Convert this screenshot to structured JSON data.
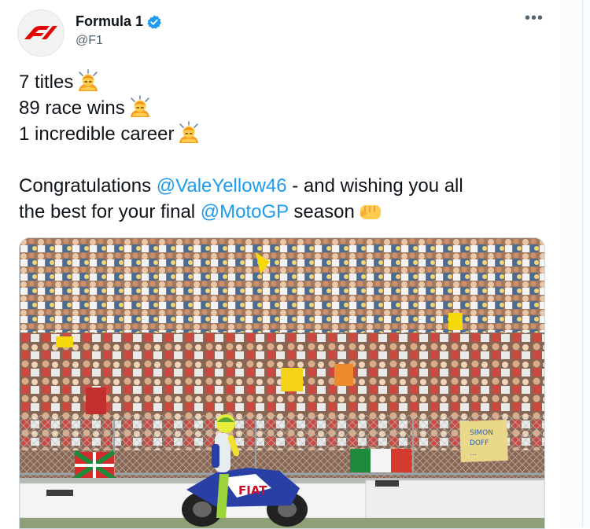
{
  "tweet": {
    "author": {
      "display_name": "Formula 1",
      "handle": "@F1",
      "verified": true,
      "avatar_icon": "f1-logo-icon"
    },
    "more_icon": "more-options-icon",
    "lines": {
      "titles": "7 titles",
      "wins": "89 race wins",
      "career": "1 incredible career",
      "congrats_prefix": "Congratulations ",
      "mention_rider": "@ValeYellow46",
      "congrats_suffix": " - and wishing you all",
      "season_prefix": "the best for your final ",
      "mention_series": "@MotoGP",
      "season_suffix": " season"
    },
    "emojis": [
      "person-bowing-emoji",
      "person-bowing-emoji",
      "person-bowing-emoji",
      "raised-fist-emoji"
    ],
    "media": {
      "kind": "photo",
      "bike_livery_text": "FIAT",
      "banner_text_1": "SIMON",
      "banner_text_2": "DOFF",
      "banner_text_3": "..."
    }
  },
  "colors": {
    "link": "#1d9bf0",
    "verified": "#1d9bf0",
    "brand_red": "#e10600",
    "text": "#0f1419",
    "muted": "#536471"
  }
}
